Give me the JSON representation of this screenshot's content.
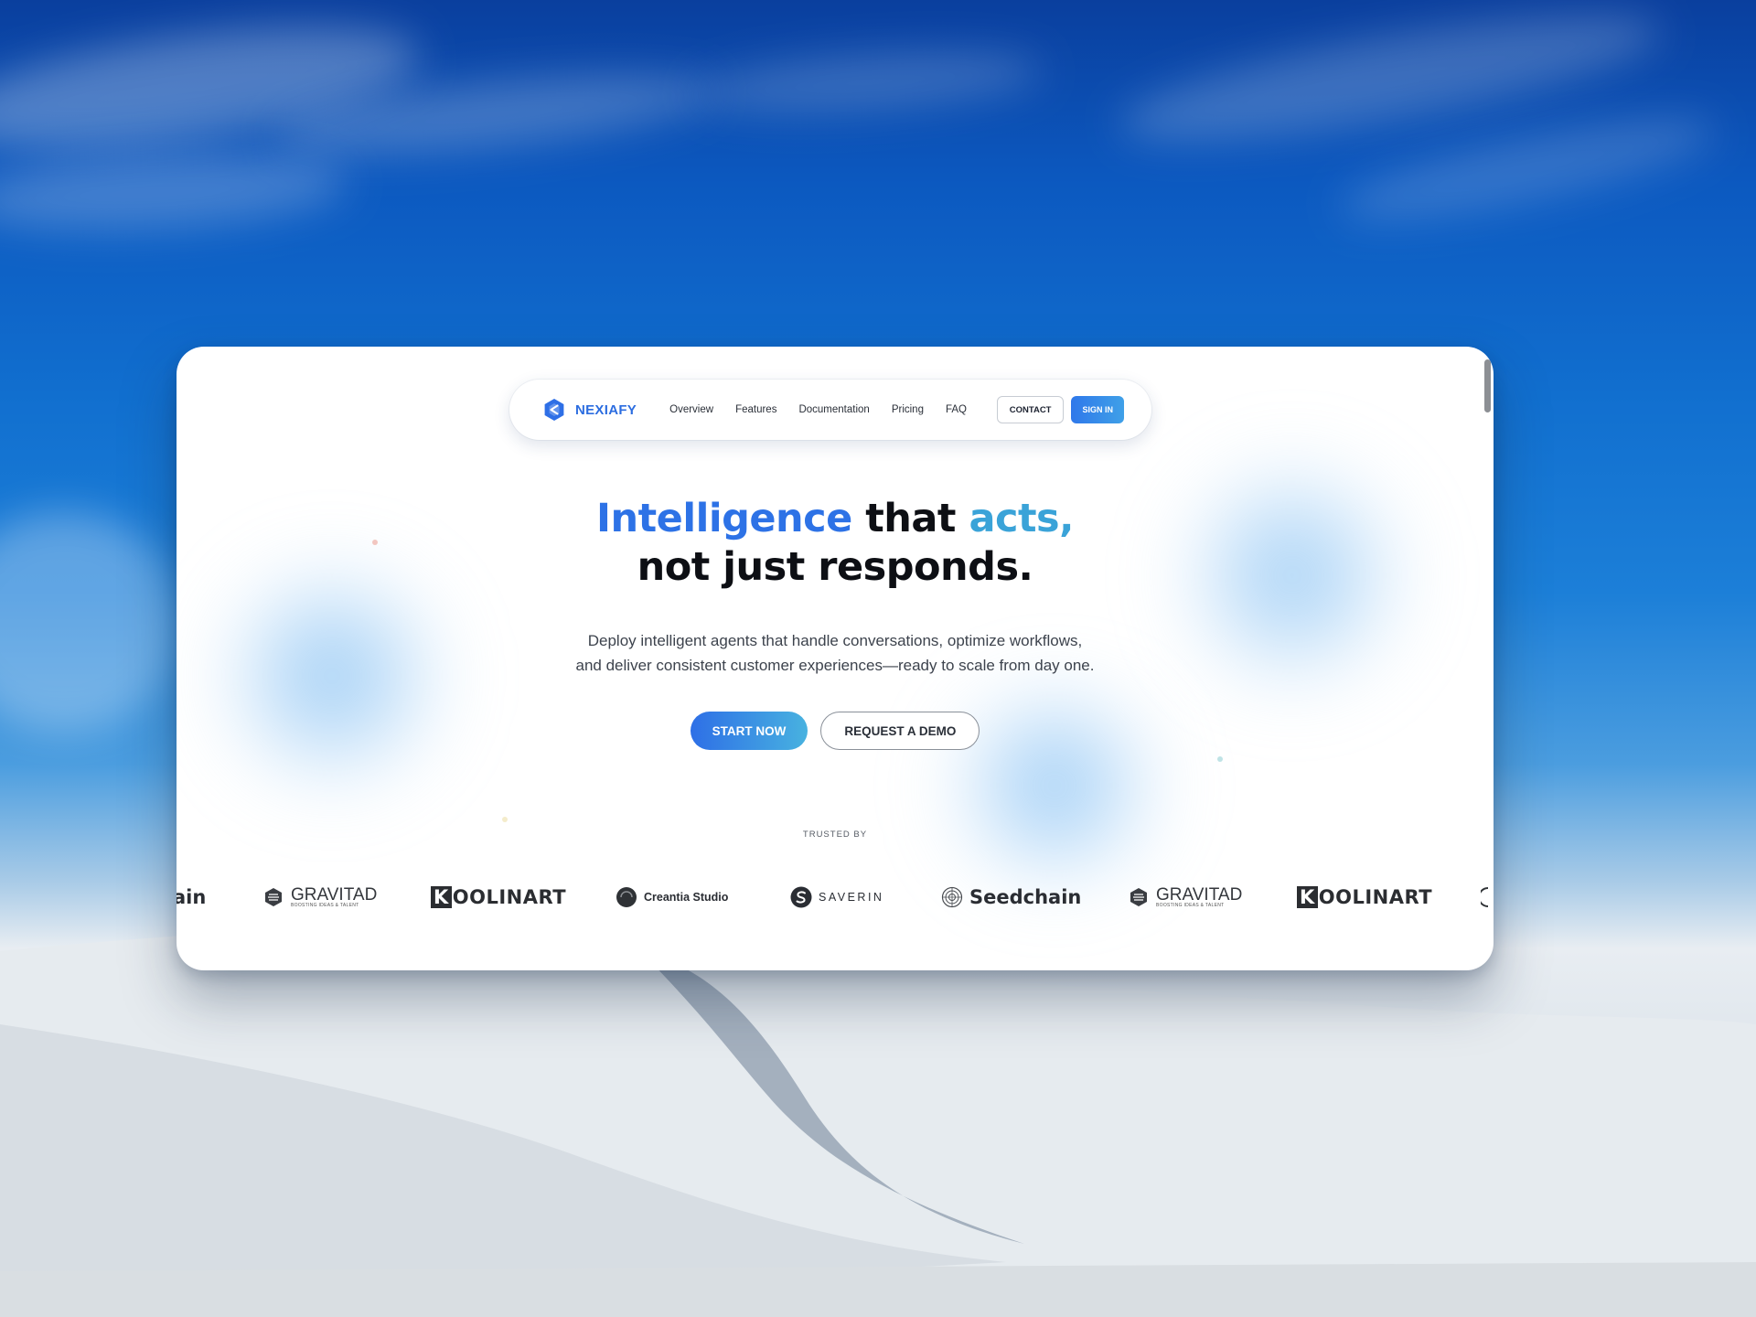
{
  "nav": {
    "brand": "NEXIAFY",
    "links": [
      "Overview",
      "Features",
      "Documentation",
      "Pricing",
      "FAQ"
    ],
    "contact_label": "CONTACT",
    "signin_label": "SIGN IN"
  },
  "hero": {
    "headline_part1": "Intelligence",
    "headline_part2": " that ",
    "headline_part3": "acts,",
    "headline_line2": "not just responds.",
    "subtext": "Deploy intelligent agents that handle conversations, optimize workflows, and deliver consistent customer experiences—ready to scale from day one.",
    "primary_cta": "START NOW",
    "secondary_cta": "REQUEST A DEMO"
  },
  "trusted": {
    "label": "TRUSTED BY",
    "fragment_left": "ain",
    "gravitad_name": "GRAVITAD",
    "gravitad_tagline": "BOOSTING IDEAS & TALENT",
    "koolinart_k": "K",
    "koolinart_rest": "OOLINART",
    "creantia": "Creantia Studio",
    "saverin": "SAVERIN",
    "seedchain": "Seedchain"
  },
  "colors": {
    "accent_blue": "#2d72e6",
    "accent_teal": "#3aa3d8",
    "text_dark": "#0d0f14"
  }
}
